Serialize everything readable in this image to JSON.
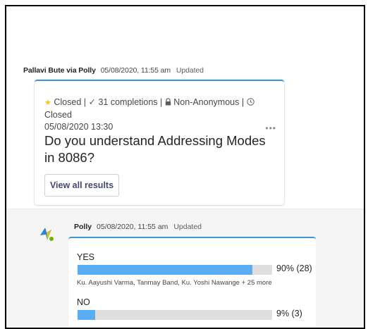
{
  "message1": {
    "sender": "Pallavi Bute via Polly",
    "timestamp": "05/08/2020, 11:55 am",
    "status": "Updated"
  },
  "poll_card": {
    "state": "Closed",
    "completions": "31 completions",
    "anonymity": "Non-Anonymous",
    "closed_label": "Closed",
    "closed_date": "05/08/2020 13:30",
    "question": "Do you understand Addressing Modes in 8086?",
    "more_label": "•••",
    "button_label": "View all results"
  },
  "message2": {
    "sender": "Polly",
    "timestamp": "05/08/2020, 11:55 am",
    "status": "Updated"
  },
  "results": [
    {
      "option": "YES",
      "fraction": 0.9,
      "percent_text": "90% (28)",
      "voters": "Ku. Aayushi Varma, Tanmay Band, Ku. Yoshi Nawange + 25 more"
    },
    {
      "option": "NO",
      "fraction": 0.09,
      "percent_text": "9% (3)",
      "voters": ""
    }
  ],
  "colors": {
    "accent": "#3b95d6",
    "bar": "#59aef3",
    "presence": "#6bb700",
    "star": "#f2c811"
  }
}
